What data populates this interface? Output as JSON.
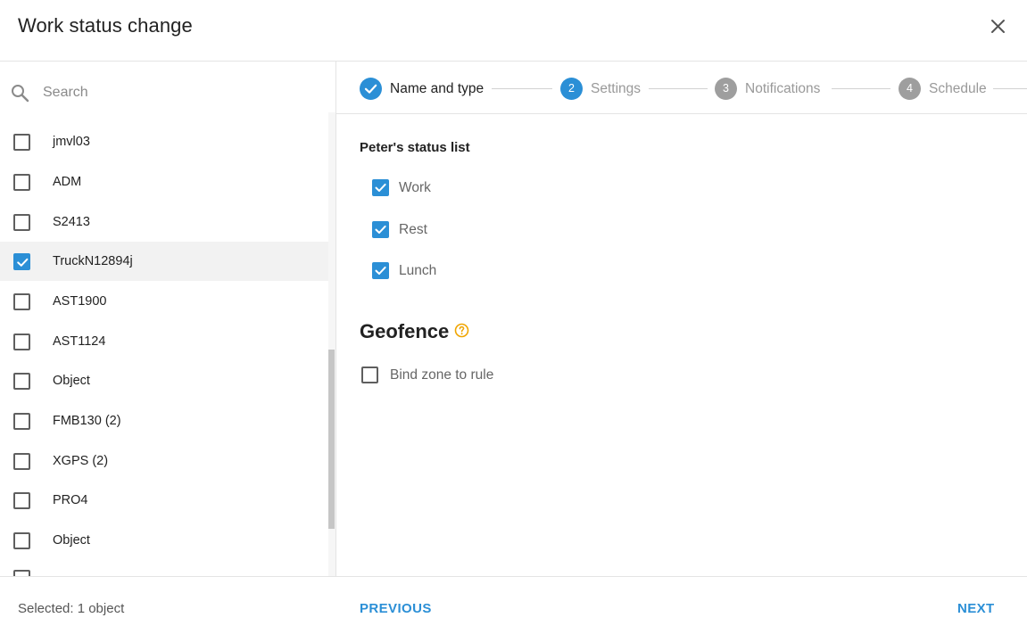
{
  "dialog": {
    "title": "Work status change"
  },
  "search": {
    "placeholder": "Search"
  },
  "objects": [
    {
      "label": "jmvl03",
      "checked": false
    },
    {
      "label": "ADM",
      "checked": false
    },
    {
      "label": "S2413",
      "checked": false
    },
    {
      "label": "TruckN12894j",
      "checked": true
    },
    {
      "label": "AST1900",
      "checked": false
    },
    {
      "label": "AST1124",
      "checked": false
    },
    {
      "label": "Object",
      "checked": false
    },
    {
      "label": "FMB130 (2)",
      "checked": false
    },
    {
      "label": "XGPS (2)",
      "checked": false
    },
    {
      "label": "PRO4",
      "checked": false
    },
    {
      "label": "Object",
      "checked": false
    }
  ],
  "steps": [
    {
      "number": "",
      "label": "Name and type",
      "state": "done"
    },
    {
      "number": "2",
      "label": "Settings",
      "state": "active"
    },
    {
      "number": "3",
      "label": "Notifications",
      "state": "pending"
    },
    {
      "number": "4",
      "label": "Schedule",
      "state": "pending"
    }
  ],
  "status_list": {
    "title": "Peter's status list",
    "items": [
      {
        "label": "Work",
        "checked": true
      },
      {
        "label": "Rest",
        "checked": true
      },
      {
        "label": "Lunch",
        "checked": true
      }
    ]
  },
  "geofence": {
    "title": "Geofence",
    "bind_label": "Bind zone to rule",
    "bind_checked": false
  },
  "footer": {
    "selected_text": "Selected: 1 object",
    "previous_label": "PREVIOUS",
    "next_label": "NEXT"
  },
  "colors": {
    "accent": "#2b8fd6",
    "step_pending": "#9e9e9e",
    "help_icon": "#f0a500",
    "selected_row": "#f2f2f2"
  }
}
